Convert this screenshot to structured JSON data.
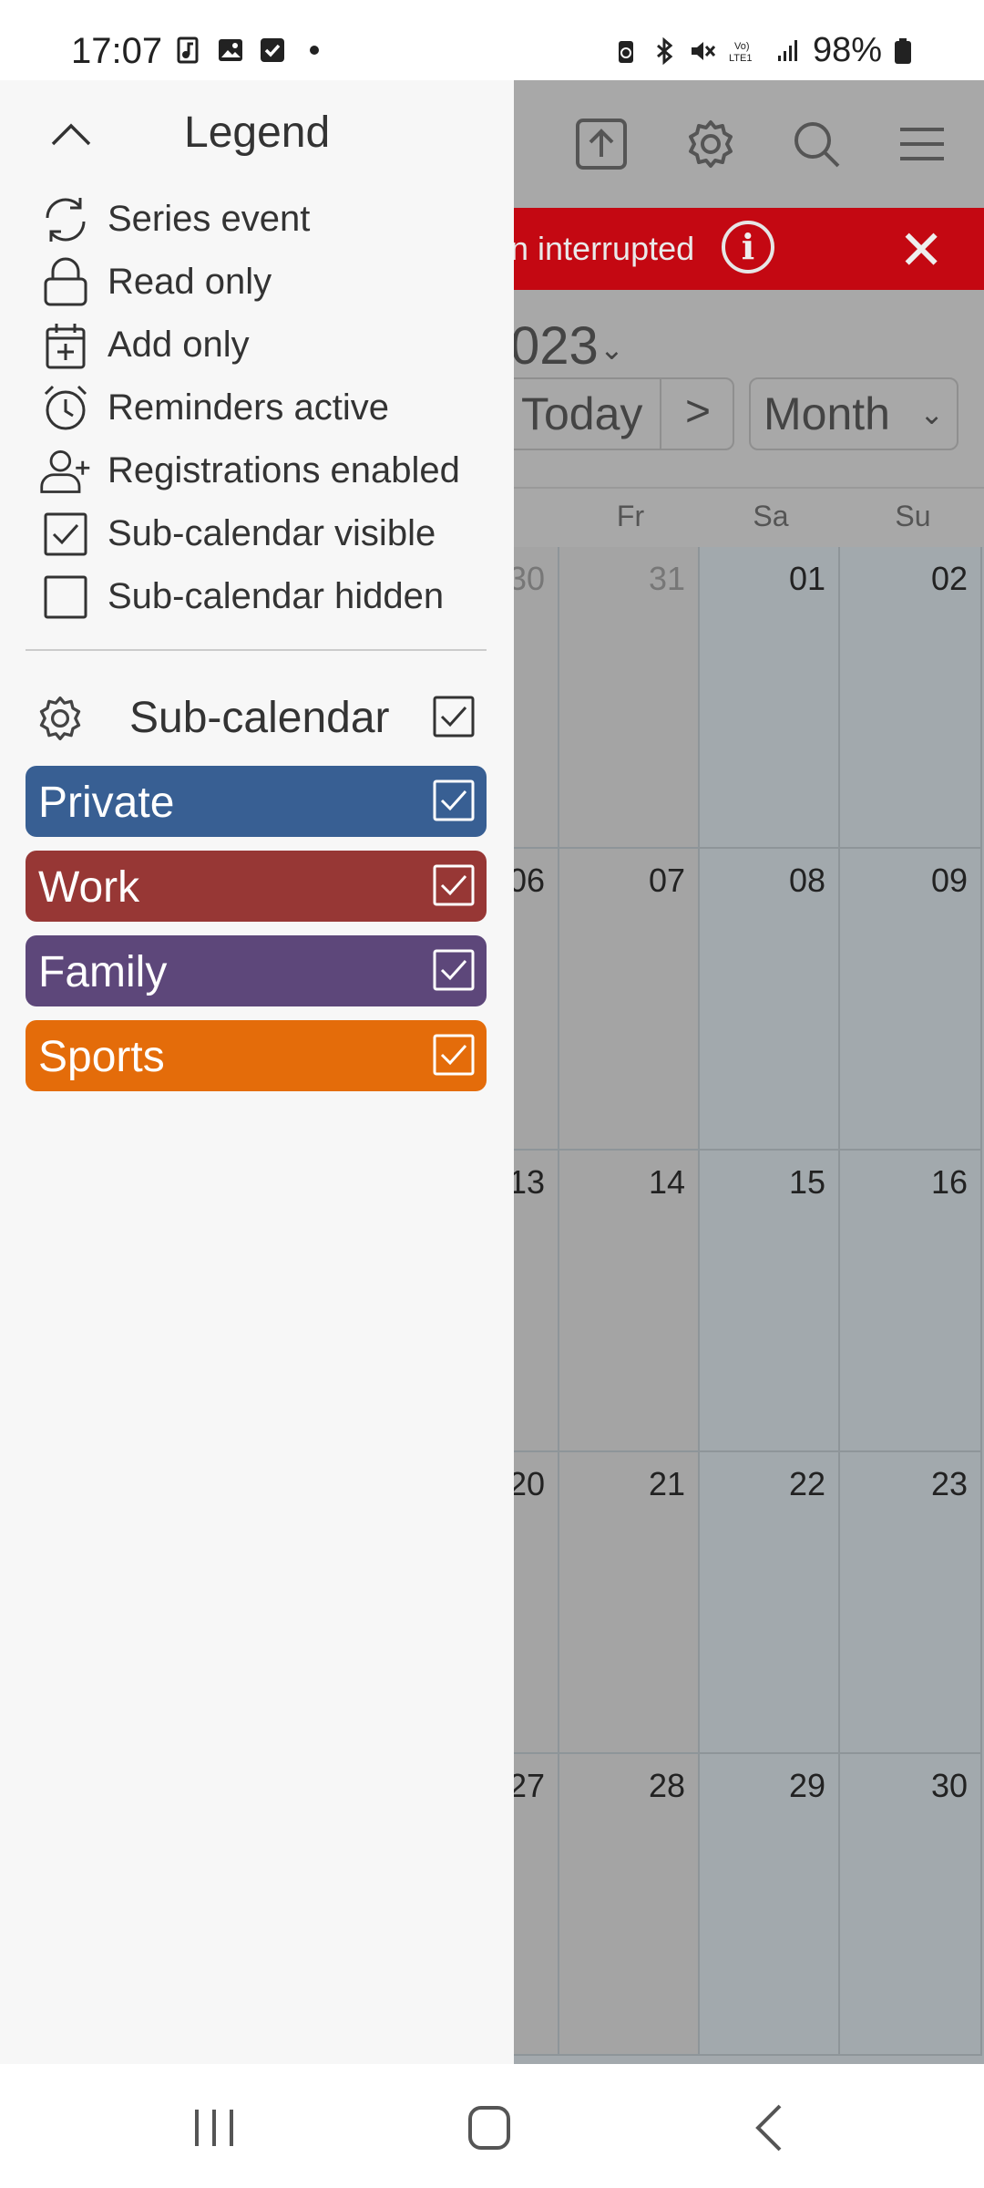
{
  "status_bar": {
    "time": "17:07",
    "battery": "98%",
    "icons": [
      "music-file-icon",
      "image-icon",
      "checkbox-icon",
      "dot-icon",
      "battery-saver-icon",
      "bluetooth-icon",
      "mute-icon",
      "volte-icon",
      "signal-icon",
      "battery-icon"
    ]
  },
  "drawer": {
    "legend_title": "Legend",
    "legend_items": [
      {
        "icon": "series-event-icon",
        "label": "Series event"
      },
      {
        "icon": "lock-icon",
        "label": "Read only"
      },
      {
        "icon": "calendar-add-icon",
        "label": "Add only"
      },
      {
        "icon": "alarm-clock-icon",
        "label": "Reminders active"
      },
      {
        "icon": "user-add-icon",
        "label": "Registrations enabled"
      },
      {
        "icon": "checkbox-checked-icon",
        "label": "Sub-calendar visible"
      },
      {
        "icon": "checkbox-empty-icon",
        "label": "Sub-calendar hidden"
      }
    ],
    "subcalendar_title": "Sub-calendar",
    "subcalendars": [
      {
        "label": "Private",
        "color": "#385f93",
        "checked": true
      },
      {
        "label": "Work",
        "color": "#973735",
        "checked": true
      },
      {
        "label": "Family",
        "color": "#5d477a",
        "checked": true
      },
      {
        "label": "Sports",
        "color": "#e46c0a",
        "checked": true
      }
    ]
  },
  "calendar": {
    "toolbar_icons": [
      "upload-icon",
      "settings-icon",
      "search-icon",
      "menu-icon"
    ],
    "banner_text": "n interrupted",
    "year_partial": "023",
    "today_label": "Today",
    "next_label": ">",
    "view_label": "Month",
    "day_headers": [
      "Fr",
      "Sa",
      "Su"
    ],
    "weeks": [
      [
        "30",
        "31",
        "01",
        "02"
      ],
      [
        "06",
        "07",
        "08",
        "09"
      ],
      [
        "13",
        "14",
        "15",
        "16"
      ],
      [
        "20",
        "21",
        "22",
        "23"
      ],
      [
        "27",
        "28",
        "29",
        "30"
      ]
    ]
  }
}
